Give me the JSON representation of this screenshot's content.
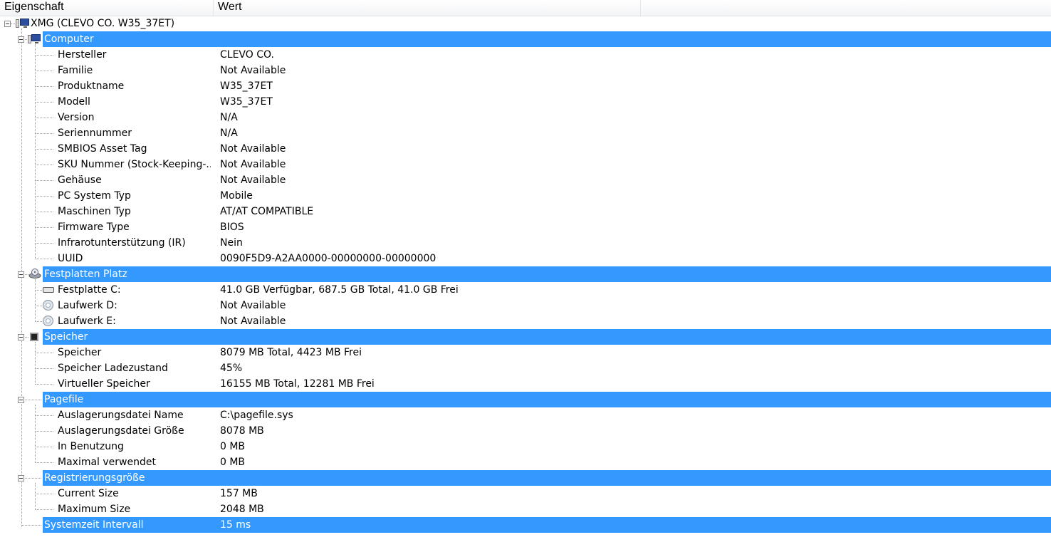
{
  "columns": {
    "property": "Eigenschaft",
    "value": "Wert"
  },
  "root": {
    "label": "XMG (CLEVO CO. W35_37ET)",
    "icon": "computer-icon"
  },
  "groups": {
    "computer": {
      "title": "Computer",
      "icon": "computer-icon",
      "items": [
        {
          "p": "Hersteller",
          "v": "CLEVO CO."
        },
        {
          "p": "Familie",
          "v": "Not Available"
        },
        {
          "p": "Produktname",
          "v": "W35_37ET"
        },
        {
          "p": "Modell",
          "v": "W35_37ET"
        },
        {
          "p": "Version",
          "v": "N/A"
        },
        {
          "p": "Seriennummer",
          "v": "N/A"
        },
        {
          "p": "SMBIOS Asset Tag",
          "v": "Not Available"
        },
        {
          "p": "SKU Nummer (Stock-Keeping-...",
          "v": "Not Available"
        },
        {
          "p": "Gehäuse",
          "v": "Not Available"
        },
        {
          "p": "PC System Typ",
          "v": "Mobile"
        },
        {
          "p": "Maschinen Typ",
          "v": "AT/AT COMPATIBLE"
        },
        {
          "p": "Firmware Type",
          "v": "BIOS"
        },
        {
          "p": "Infrarotunterstützung (IR)",
          "v": "Nein"
        },
        {
          "p": "UUID",
          "v": "0090F5D9-A2AA0000-00000000-00000000"
        }
      ]
    },
    "disks": {
      "title": "Festplatten Platz",
      "icon": "drive-icon",
      "items": [
        {
          "p": "Festplatte C:",
          "v": "41.0 GB Verfügbar, 687.5 GB Total, 41.0 GB Frei",
          "icon": "hard-disk-icon"
        },
        {
          "p": "Laufwerk D:",
          "v": "Not Available",
          "icon": "optical-disc-icon"
        },
        {
          "p": "Laufwerk E:",
          "v": "Not Available",
          "icon": "optical-disc-icon"
        }
      ]
    },
    "memory": {
      "title": "Speicher",
      "icon": "memory-chip-icon",
      "items": [
        {
          "p": "Speicher",
          "v": "8079 MB Total, 4423 MB Frei"
        },
        {
          "p": "Speicher Ladezustand",
          "v": "45%"
        },
        {
          "p": "Virtueller Speicher",
          "v": "16155 MB Total, 12281 MB Frei"
        }
      ]
    },
    "pagefile": {
      "title": "Pagefile",
      "items": [
        {
          "p": "Auslagerungsdatei Name",
          "v": "C:\\pagefile.sys"
        },
        {
          "p": "Auslagerungsdatei Größe",
          "v": "8078 MB"
        },
        {
          "p": "In Benutzung",
          "v": "0 MB"
        },
        {
          "p": "Maximal verwendet",
          "v": "0 MB"
        }
      ]
    },
    "registry": {
      "title": "Registrierungsgröße",
      "items": [
        {
          "p": "Current Size",
          "v": "157 MB"
        },
        {
          "p": "Maximum Size",
          "v": "2048 MB"
        }
      ]
    }
  },
  "systemtime": {
    "p": "Systemzeit Intervall",
    "v": "15 ms"
  },
  "colors": {
    "selection": "#3399ff",
    "selection_text": "#ffffff"
  }
}
